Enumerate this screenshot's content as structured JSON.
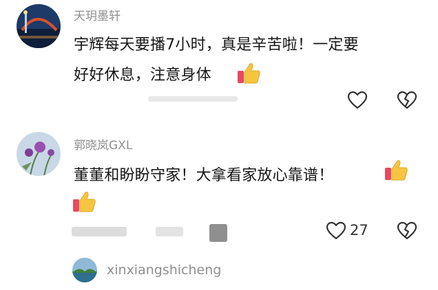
{
  "comments": [
    {
      "user": "天玥墨轩",
      "text_lines": [
        "宇辉每天要播7小时，真是辛苦啦！一定要",
        "好好休息，注意身体"
      ],
      "like_count": "",
      "emoji": "thumbs-up"
    },
    {
      "user": "郭晓岚GXL",
      "text_lines": [
        "董董和盼盼守家！大拿看家放心靠谱！"
      ],
      "like_count": "27",
      "emoji": "thumbs-up"
    }
  ],
  "reply_preview": {
    "user": "xinxiangshicheng"
  },
  "icons": [
    "like-heart-icon",
    "dislike-broken-heart-icon",
    "thumbs-up-emoji"
  ],
  "colors": {
    "text": "#161616",
    "username": "#8f8f8f",
    "icon_stroke": "#333333",
    "thumb_yellow": "#f5c542",
    "thumb_red": "#e84a5f"
  }
}
